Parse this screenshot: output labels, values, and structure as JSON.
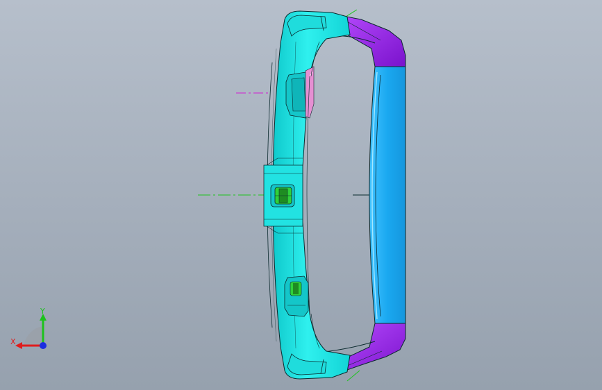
{
  "viewport": {
    "background_top": "#b6bfcb",
    "background_bottom": "#96a1ae"
  },
  "model": {
    "colors": {
      "body": "#19e6e6",
      "body_shade": "#0fc9cc",
      "lens": "#1aa8f0",
      "lens_light": "#41c2ff",
      "corner": "#8d1de0",
      "corner_light": "#b84dff",
      "clip_green": "#1e8c22",
      "clip_green_light": "#2fd13a",
      "highlight_pink": "#e58fd2",
      "edge": "#0b2a2e"
    },
    "centerlines": {
      "horizontal_color": "#1fc41f",
      "upper_mark_color": "#d21ed2",
      "lower_mark_color": "#1fc41f"
    }
  },
  "triad": {
    "icon": "coordinate-triad-icon",
    "x_label": "X",
    "y_label": "Y",
    "x_color": "#e01c1c",
    "y_color": "#1cc21c",
    "z_color": "#1c2ee0"
  }
}
